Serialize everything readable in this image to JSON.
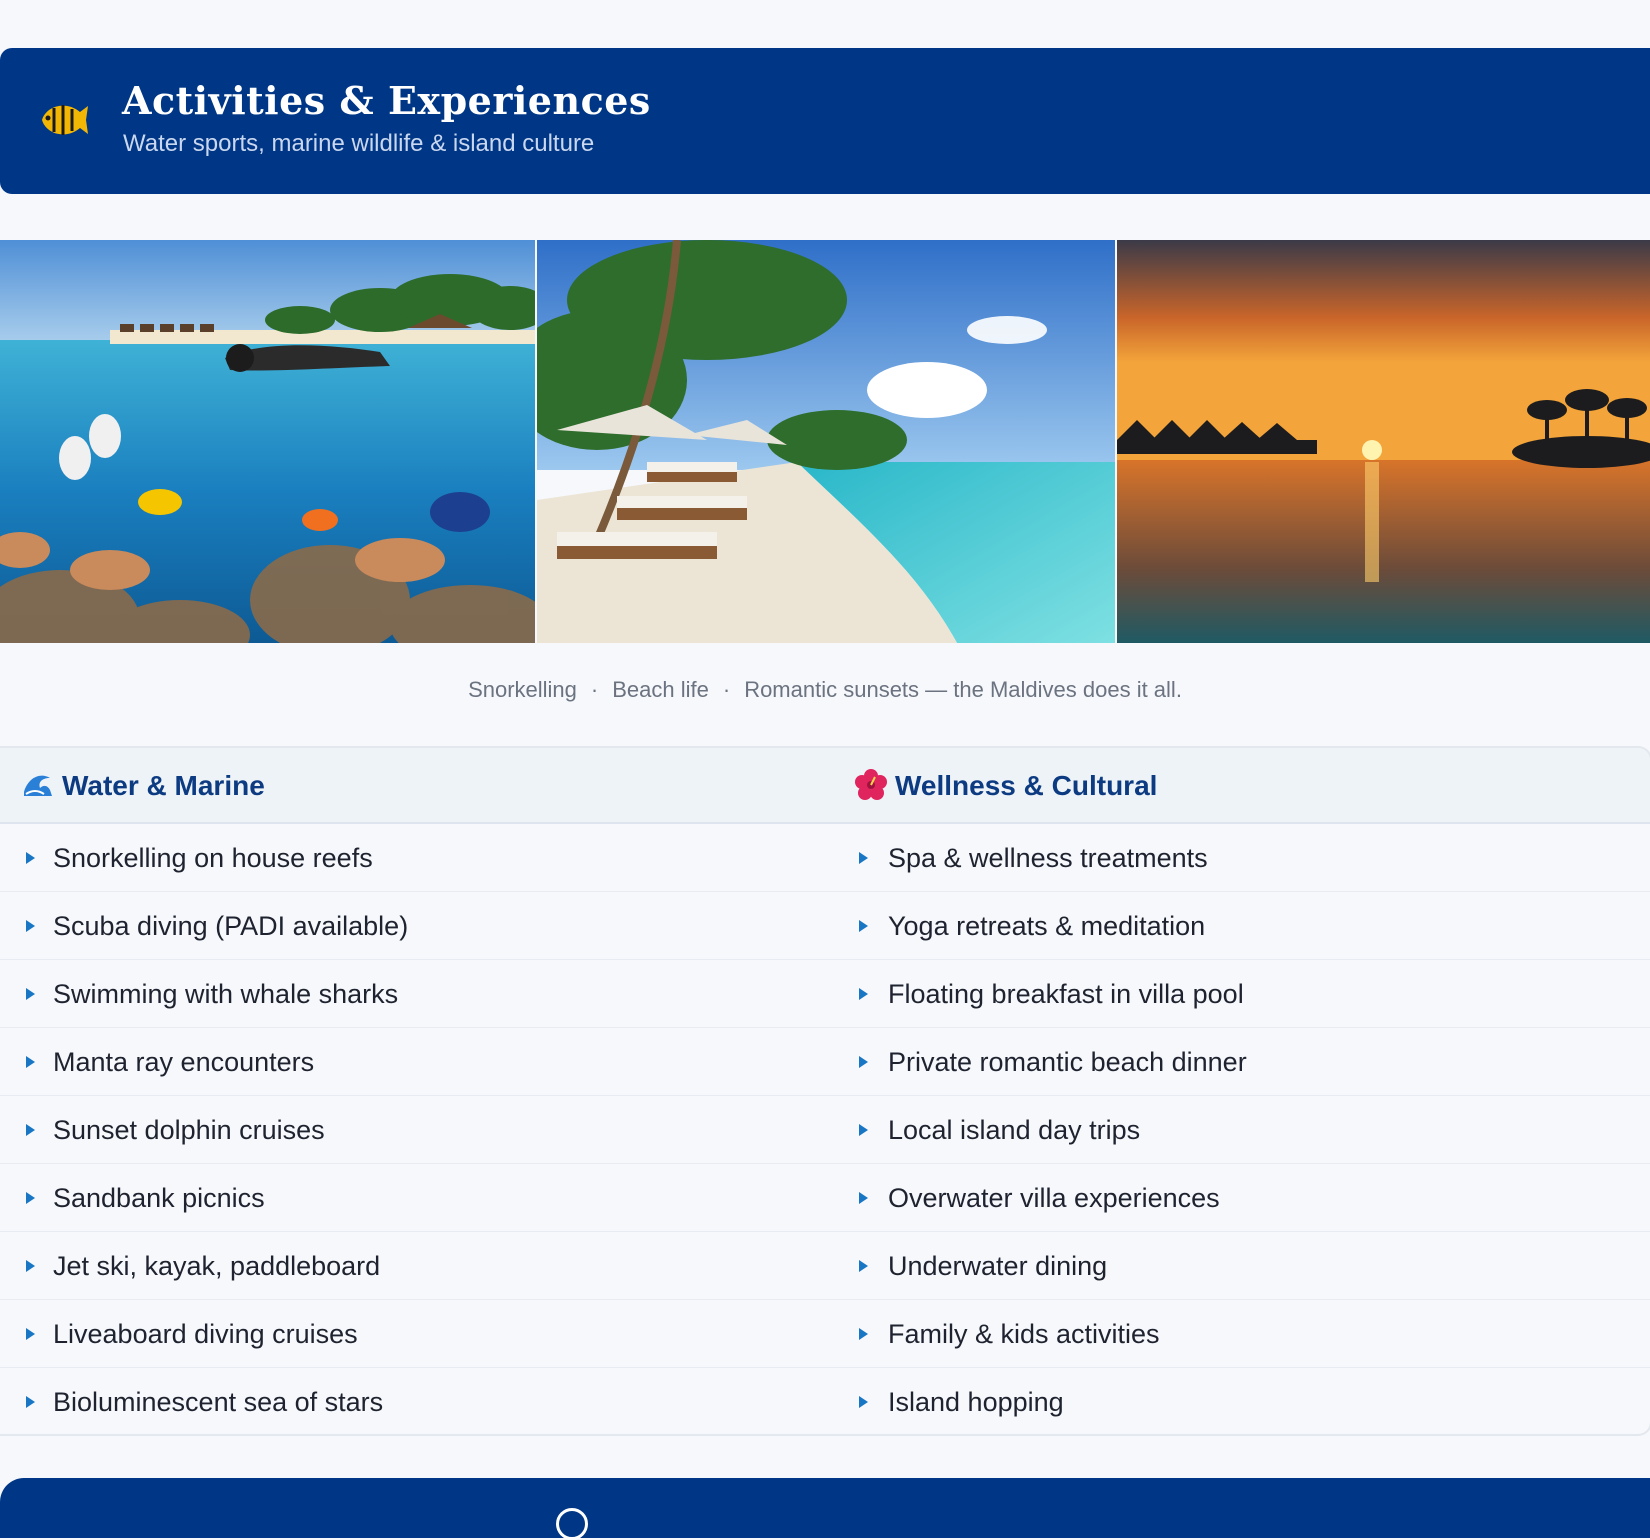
{
  "header": {
    "title": "Activities & Experiences",
    "subtitle": "Water sports, marine wildlife & island culture",
    "icon": "tropical-fish-icon"
  },
  "gallery": {
    "images": [
      {
        "subject": "snorkelling-coral-reef"
      },
      {
        "subject": "beach-loungers-palms"
      },
      {
        "subject": "sunset-overwater-villas"
      }
    ],
    "caption_parts": [
      "Snorkelling",
      "Beach life",
      "Romantic sunsets — the Maldives does it all."
    ],
    "separator": "·"
  },
  "activities": {
    "water": {
      "icon": "wave-icon",
      "title": "Water & Marine",
      "items": [
        "Snorkelling on house reefs",
        "Scuba diving (PADI available)",
        "Swimming with whale sharks",
        "Manta ray encounters",
        "Sunset dolphin cruises",
        "Sandbank picnics",
        "Jet ski, kayak, paddleboard",
        "Liveaboard diving cruises",
        "Bioluminescent sea of stars"
      ]
    },
    "wellness": {
      "icon": "hibiscus-icon",
      "title": "Wellness & Cultural",
      "items": [
        "Spa & wellness treatments",
        "Yoga retreats & meditation",
        "Floating breakfast in villa pool",
        "Private romantic beach dinner",
        "Local island day trips",
        "Overwater villa experiences",
        "Underwater dining",
        "Family & kids activities",
        "Island hopping"
      ]
    }
  },
  "colors": {
    "brand": "#003686",
    "accent": "#1976c5",
    "heading": "#0d3b82"
  }
}
